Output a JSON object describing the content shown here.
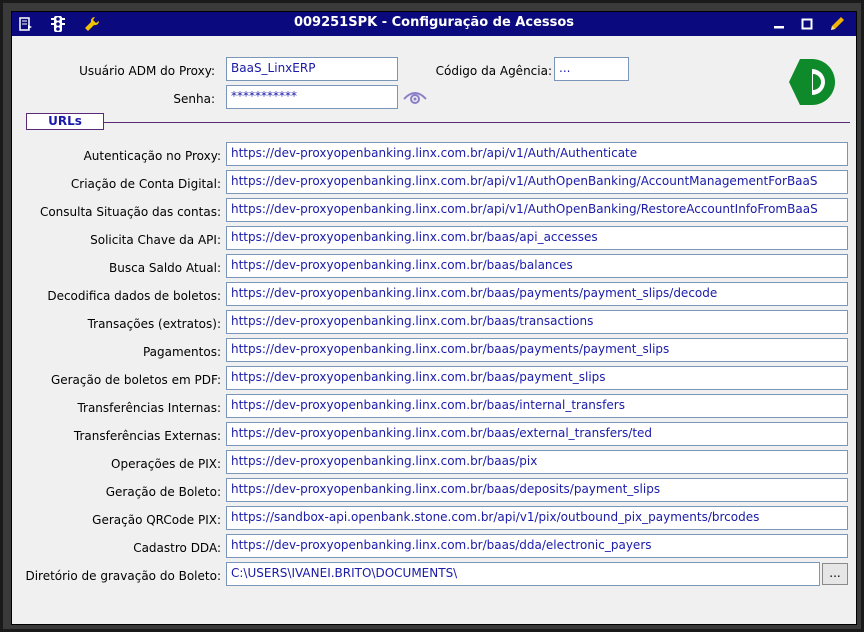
{
  "window": {
    "title": "009251SPK - Configuração de Acessos",
    "titlebar_color": "#0a0a7e",
    "left_icons": [
      "report-icon",
      "traffic-light-icon",
      "wrench-icon"
    ],
    "right_icons": [
      "minimize-icon",
      "maximize-icon",
      "edit-pencil-icon"
    ]
  },
  "proxy": {
    "user_label": "Usuário ADM do Proxy:",
    "user_value": "BaaS_LinxERP",
    "password_label": "Senha:",
    "password_value": "***********",
    "agency_label": "Código da Agência:",
    "agency_value": "...",
    "show_password_icon": "eye-icon",
    "logo_icon": "green-logo-icon",
    "logo_color": "#0f8a2a"
  },
  "section": {
    "urls_label": "URLs"
  },
  "urls": [
    {
      "label": "Autenticação no Proxy:",
      "value": "https://dev-proxyopenbanking.linx.com.br/api/v1/Auth/Authenticate"
    },
    {
      "label": "Criação de Conta Digital:",
      "value": "https://dev-proxyopenbanking.linx.com.br/api/v1/AuthOpenBanking/AccountManagementForBaaS"
    },
    {
      "label": "Consulta Situação das contas:",
      "value": "https://dev-proxyopenbanking.linx.com.br/api/v1/AuthOpenBanking/RestoreAccountInfoFromBaaS"
    },
    {
      "label": "Solicita Chave da API:",
      "value": "https://dev-proxyopenbanking.linx.com.br/baas/api_accesses"
    },
    {
      "label": "Busca Saldo Atual:",
      "value": "https://dev-proxyopenbanking.linx.com.br/baas/balances"
    },
    {
      "label": "Decodifica dados de boletos:",
      "value": "https://dev-proxyopenbanking.linx.com.br/baas/payments/payment_slips/decode"
    },
    {
      "label": "Transações (extratos):",
      "value": "https://dev-proxyopenbanking.linx.com.br/baas/transactions"
    },
    {
      "label": "Pagamentos:",
      "value": "https://dev-proxyopenbanking.linx.com.br/baas/payments/payment_slips"
    },
    {
      "label": "Geração de boletos em PDF:",
      "value": "https://dev-proxyopenbanking.linx.com.br/baas/payment_slips"
    },
    {
      "label": "Transferências Internas:",
      "value": "https://dev-proxyopenbanking.linx.com.br/baas/internal_transfers"
    },
    {
      "label": "Transferências Externas:",
      "value": "https://dev-proxyopenbanking.linx.com.br/baas/external_transfers/ted"
    },
    {
      "label": "Operações de PIX:",
      "value": "https://dev-proxyopenbanking.linx.com.br/baas/pix"
    },
    {
      "label": "Geração de Boleto:",
      "value": "https://dev-proxyopenbanking.linx.com.br/baas/deposits/payment_slips"
    },
    {
      "label": "Geração QRCode PIX:",
      "value": "https://sandbox-api.openbank.stone.com.br/api/v1/pix/outbound_pix_payments/brcodes"
    },
    {
      "label": "Cadastro DDA:",
      "value": "https://dev-proxyopenbanking.linx.com.br/baas/dda/electronic_payers"
    }
  ],
  "directory": {
    "label": "Diretório de gravação do Boleto:",
    "value": "C:\\USERS\\IVANEI.BRITO\\DOCUMENTS\\",
    "browse_label": "..."
  }
}
